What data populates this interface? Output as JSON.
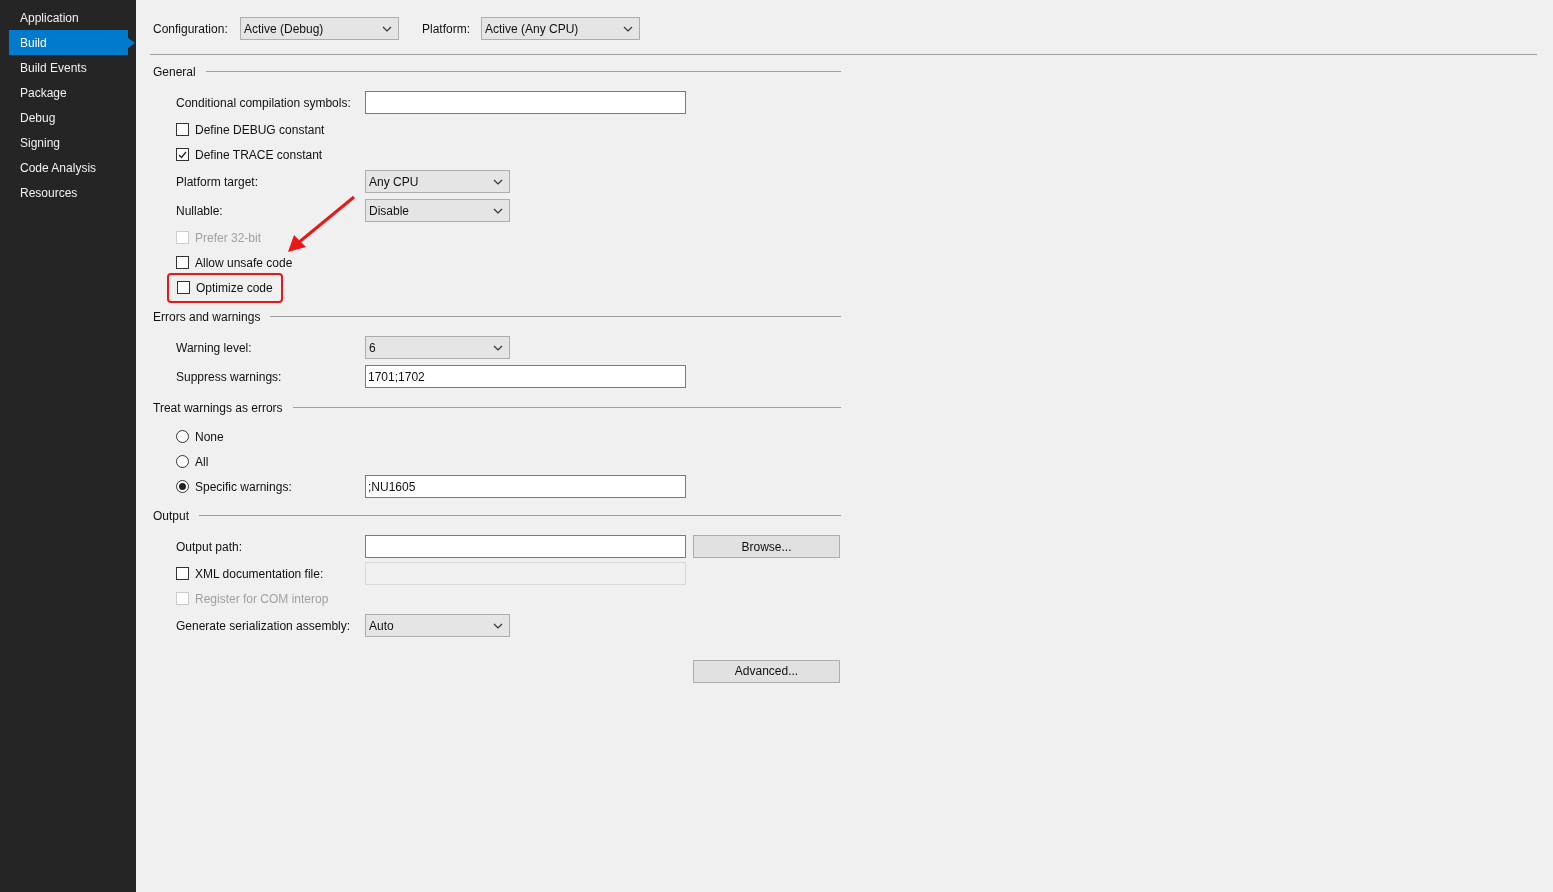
{
  "sidebar": {
    "items": [
      {
        "label": "Application",
        "selected": false
      },
      {
        "label": "Build",
        "selected": true
      },
      {
        "label": "Build Events",
        "selected": false
      },
      {
        "label": "Package",
        "selected": false
      },
      {
        "label": "Debug",
        "selected": false
      },
      {
        "label": "Signing",
        "selected": false
      },
      {
        "label": "Code Analysis",
        "selected": false
      },
      {
        "label": "Resources",
        "selected": false
      }
    ]
  },
  "toolbar": [
    {
      "label": "Configuration:",
      "value": "Active (Debug)"
    },
    {
      "label": "Platform:",
      "value": "Active (Any CPU)"
    }
  ],
  "sections": [
    {
      "title": "General",
      "rows": [
        {
          "kind": "text",
          "label": "Conditional compilation symbols:"
        },
        {
          "kind": "check",
          "label": "Define DEBUG constant",
          "checked": false,
          "disabled": false
        },
        {
          "kind": "check",
          "label": "Define TRACE constant",
          "checked": true,
          "disabled": false
        },
        {
          "kind": "select",
          "label": "Platform target:",
          "value": "Any CPU"
        },
        {
          "kind": "select",
          "label": "Nullable:",
          "value": "Disable"
        },
        {
          "kind": "check",
          "label": "Prefer 32-bit",
          "checked": false,
          "disabled": true
        },
        {
          "kind": "check",
          "label": "Allow unsafe code",
          "checked": false,
          "disabled": false
        },
        {
          "kind": "check",
          "label": "Optimize code",
          "checked": false,
          "disabled": false,
          "highlighted": true
        }
      ]
    },
    {
      "title": "Errors and warnings",
      "rows": [
        {
          "kind": "select",
          "label": "Warning level:",
          "value": "6"
        },
        {
          "kind": "text",
          "label": "Suppress warnings:",
          "value": "1701;1702"
        }
      ]
    },
    {
      "title": "Treat warnings as errors",
      "rows": [
        {
          "kind": "radio",
          "label": "None",
          "selected": false
        },
        {
          "kind": "radio",
          "label": "All",
          "selected": false
        },
        {
          "kind": "radio",
          "label": "Specific warnings:",
          "selected": true,
          "value": ";NU1605"
        }
      ]
    },
    {
      "title": "Output",
      "rows": [
        {
          "kind": "text",
          "label": "Output path:",
          "button": "Browse..."
        },
        {
          "kind": "check",
          "label": "XML documentation file:",
          "checked": false,
          "disabled": false,
          "field_disabled": true
        },
        {
          "kind": "check",
          "label": "Register for COM interop",
          "checked": false,
          "disabled": true
        },
        {
          "kind": "select",
          "label": "Generate serialization assembly:",
          "value": "Auto"
        },
        {
          "kind": "button",
          "button": "Advanced..."
        }
      ]
    }
  ]
}
